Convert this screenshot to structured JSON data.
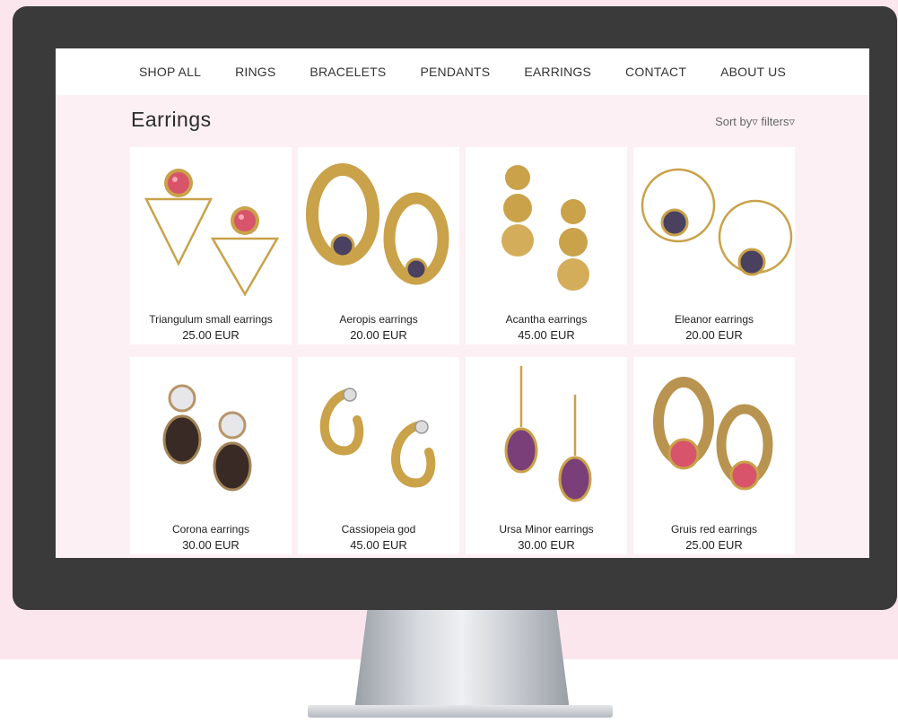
{
  "nav": [
    "SHOP ALL",
    "RINGS",
    "BRACELETS",
    "PENDANTS",
    "EARRINGS",
    "CONTACT",
    "ABOUT US"
  ],
  "page": {
    "title": "Earrings",
    "sort_label": "Sort by▿",
    "filters_label": "filters▿"
  },
  "products": [
    {
      "name": "Triangulum small earrings",
      "price": "25.00 EUR",
      "image": "triangle-ruby-earrings"
    },
    {
      "name": "Aeropis earrings",
      "price": "20.00 EUR",
      "image": "gold-oval-amethyst-earrings"
    },
    {
      "name": "Acantha earrings",
      "price": "45.00 EUR",
      "image": "gold-disc-drop-earrings"
    },
    {
      "name": "Eleanor earrings",
      "price": "20.00 EUR",
      "image": "gold-hoop-amethyst-earrings"
    },
    {
      "name": "Corona earrings",
      "price": "30.00 EUR",
      "image": "pearl-smoky-quartz-earrings"
    },
    {
      "name": "Cassiopeia god",
      "price": "45.00 EUR",
      "image": "gold-hoop-earrings"
    },
    {
      "name": "Ursa Minor earrings",
      "price": "30.00 EUR",
      "image": "purple-drop-earrings"
    },
    {
      "name": "Gruis red earrings",
      "price": "25.00 EUR",
      "image": "gold-oval-red-stone-earrings"
    }
  ],
  "colors": {
    "background": "#fbe6ee",
    "screen": "#fdf0f4",
    "monitor": "#3a3a3a",
    "gold": "#c9a24a",
    "ruby": "#d8546a",
    "amethyst": "#4a4060"
  }
}
